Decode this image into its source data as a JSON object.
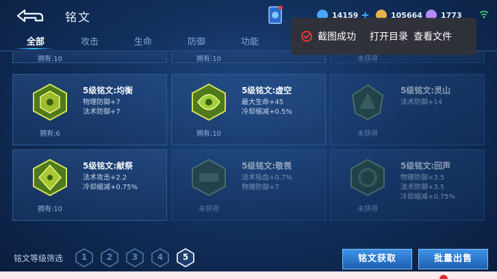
{
  "header": {
    "title": "铭文",
    "currencies": [
      {
        "icon": "diamond-coupon-icon",
        "value": "14159",
        "plus": "+",
        "color": "#4aa8ff"
      },
      {
        "icon": "gold-coin-icon",
        "value": "105664",
        "plus": "",
        "color": "#e3b34a"
      },
      {
        "icon": "gem-icon",
        "value": "1773",
        "plus": "",
        "color": "#b58cff"
      }
    ]
  },
  "tabs": [
    "全部",
    "攻击",
    "生命",
    "防御",
    "功能"
  ],
  "active_tab": "全部",
  "toast": {
    "message": "截图成功",
    "action_open_dir": "打开目录",
    "action_view_file": "查看文件"
  },
  "top_row": [
    {
      "owned": "拥有:10"
    },
    {
      "owned": "拥有:10"
    },
    {
      "owned": "未获得"
    }
  ],
  "inscriptions": [
    {
      "name": "5级铭文:均衡",
      "attrs": [
        "物理防御+7",
        "法术防御+7"
      ],
      "owned": "拥有:6",
      "obtained": true,
      "color": "#c8d64a"
    },
    {
      "name": "5级铭文:虚空",
      "attrs": [
        "最大生命+45",
        "冷却缩减+0.5%"
      ],
      "owned": "拥有:10",
      "obtained": true,
      "color": "#b8d84a"
    },
    {
      "name": "5级铭文:灵山",
      "attrs": [
        "法术防御+14"
      ],
      "owned": "未获得",
      "obtained": false,
      "color": "#6f9a70"
    },
    {
      "name": "5级铭文:献祭",
      "attrs": [
        "法术攻击+2.2",
        "冷却缩减+0.75%"
      ],
      "owned": "拥有:10",
      "obtained": true,
      "color": "#c8d64a"
    },
    {
      "name": "5级铭文:敬畏",
      "attrs": [
        "法术吸血+0.7%",
        "物理防御+7"
      ],
      "owned": "未获得",
      "obtained": false,
      "color": "#6f9a70"
    },
    {
      "name": "5级铭文:回声",
      "attrs": [
        "物理防御+3.5",
        "法术防御+3.5",
        "冷却缩减+0.75%"
      ],
      "owned": "未获得",
      "obtained": false,
      "color": "#6f9a70"
    }
  ],
  "bottom": {
    "filter_label": "铭文等级筛选",
    "levels": [
      "1",
      "2",
      "3",
      "4",
      "5"
    ],
    "active_level": "5",
    "get_button": "铭文获取",
    "sell_button": "批量出售"
  }
}
